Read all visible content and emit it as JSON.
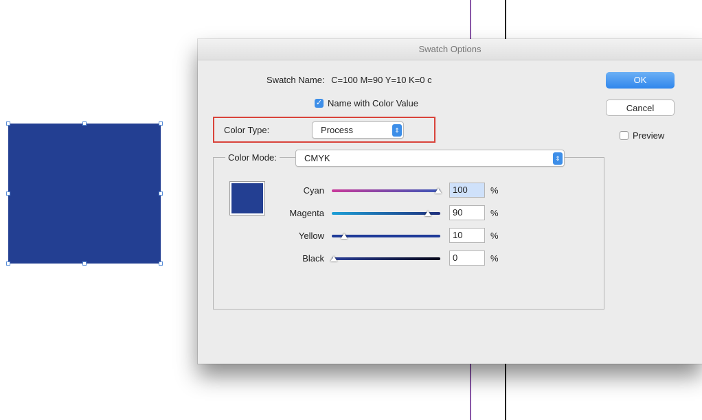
{
  "colors": {
    "swatch": "#233f92",
    "accent": "#3d8ee8",
    "highlight": "#d9433a"
  },
  "dialog": {
    "title": "Swatch Options",
    "swatch_name_label": "Swatch Name:",
    "swatch_name_value": "C=100 M=90 Y=10 K=0 c",
    "name_with_color_value_label": "Name with Color Value",
    "name_with_color_value_checked": true,
    "color_type_label": "Color Type:",
    "color_type_value": "Process",
    "color_mode_label": "Color Mode:",
    "color_mode_value": "CMYK",
    "sliders": [
      {
        "label": "Cyan",
        "value": "100",
        "unit": "%",
        "fraction": 1.0,
        "gradient": "linear-gradient(90deg, #c93a9a, #3a57b7)"
      },
      {
        "label": "Magenta",
        "value": "90",
        "unit": "%",
        "fraction": 0.9,
        "gradient": "linear-gradient(90deg, #1d9fd6, #1f2f7c)"
      },
      {
        "label": "Yellow",
        "value": "10",
        "unit": "%",
        "fraction": 0.1,
        "gradient": "linear-gradient(90deg, #1e3a98, #1e3a98)"
      },
      {
        "label": "Black",
        "value": "0",
        "unit": "%",
        "fraction": 0.0,
        "gradient": "linear-gradient(90deg, #2a3e98, #05071a)"
      }
    ],
    "ok_label": "OK",
    "cancel_label": "Cancel",
    "preview_label": "Preview",
    "preview_checked": false
  }
}
